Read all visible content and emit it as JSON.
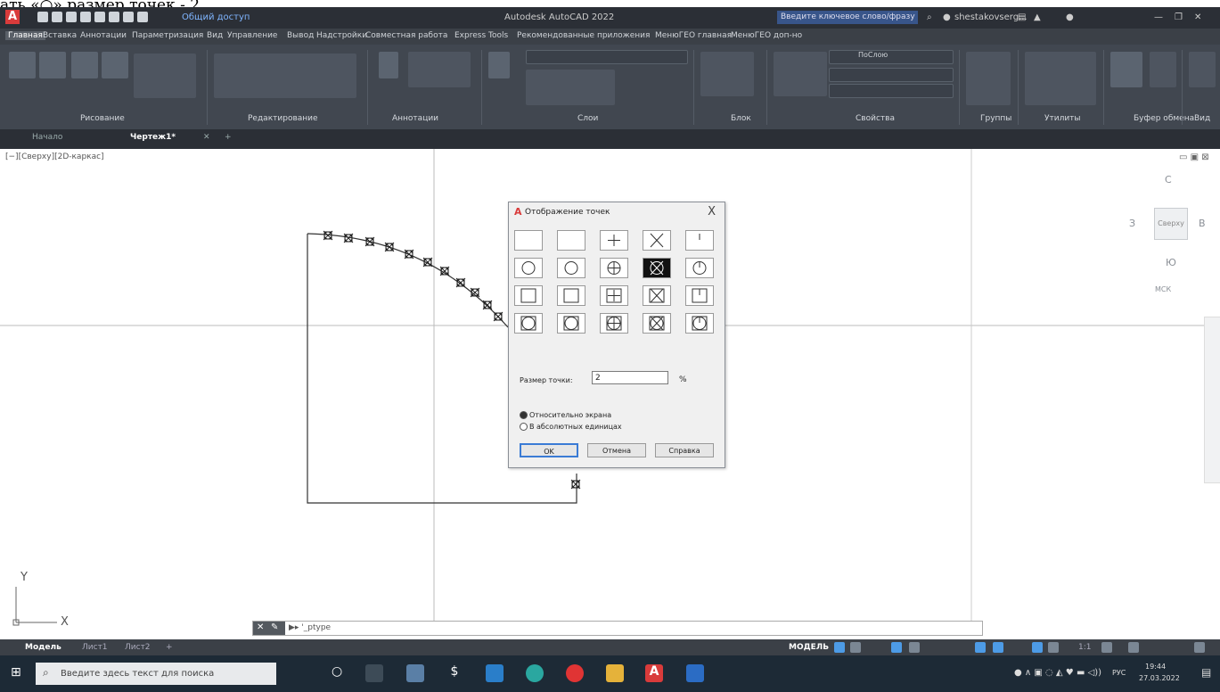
{
  "instruction_fragment": "ать «○» размер точек - 2",
  "titlebar": {
    "shared_access": "Общий доступ",
    "app_title": "Autodesk AutoCAD 2022",
    "search_placeholder": "Введите ключевое слово/фразу",
    "user": "shestakovserg..."
  },
  "menu_tabs": [
    "Главная",
    "Вставка",
    "Аннотации",
    "Параметризация",
    "Вид",
    "Управление",
    "Вывод",
    "Надстройки",
    "Совместная работа",
    "Express Tools",
    "Рекомендованные приложения",
    "МенюГЕО главная",
    "МенюГЕО доп-но"
  ],
  "ribbon": {
    "panels": [
      "Рисование",
      "Редактирование",
      "Аннотации",
      "Слои",
      "Блок",
      "Свойства",
      "Группы",
      "Утилиты",
      "Буфер обмена",
      "Вид"
    ],
    "layer_byblock": "ПоСлою"
  },
  "doc_tabs": {
    "start": "Начало",
    "drawing": "Чертеж1*"
  },
  "viewport": {
    "label": "[−][Сверху][2D-каркас]",
    "viewcube": {
      "north": "С",
      "south": "Ю",
      "west": "З",
      "east": "В",
      "face": "Сверху",
      "wcs": "МСК"
    }
  },
  "dialog": {
    "title": "Отображение точек",
    "close": "X",
    "size_label": "Размер точки:",
    "size_value": "2",
    "size_unit": "%",
    "radio_relative": "Относительно экрана",
    "radio_absolute": "В абсолютных единицах",
    "ok": "OK",
    "cancel": "Отмена",
    "help": "Справка",
    "selected_style_index": 8
  },
  "command_line": {
    "text": "▶▸ '_ptype"
  },
  "ucs": {
    "x": "X",
    "y": "Y"
  },
  "statusbar": {
    "model_tab": "Модель",
    "layout1": "Лист1",
    "layout2": "Лист2",
    "mode": "МОДЕЛЬ",
    "scale": "1:1"
  },
  "taskbar": {
    "search_placeholder": "Введите здесь текст для поиска",
    "lang": "РУС",
    "time": "19:44",
    "date": "27.03.2022"
  }
}
